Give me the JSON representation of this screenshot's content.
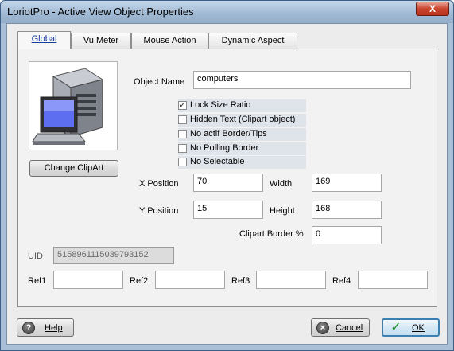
{
  "window": {
    "title": "LoriotPro - Active View Object Properties",
    "close_glyph": "X"
  },
  "tabs": [
    {
      "label": "Global",
      "active": true
    },
    {
      "label": "Vu Meter",
      "active": false
    },
    {
      "label": "Mouse Action",
      "active": false
    },
    {
      "label": "Dynamic Aspect",
      "active": false
    }
  ],
  "clipart": {
    "icon": "computer-icon",
    "button_label": "Change ClipArt"
  },
  "object_name": {
    "label": "Object Name",
    "value": "computers"
  },
  "checkboxes": [
    {
      "label": "Lock Size Ratio",
      "checked": true
    },
    {
      "label": "Hidden Text (Clipart object)",
      "checked": false
    },
    {
      "label": "No actif Border/Tips",
      "checked": false
    },
    {
      "label": "No Polling Border",
      "checked": false
    },
    {
      "label": "No Selectable",
      "checked": false
    }
  ],
  "position": {
    "x_label": "X Position",
    "x_value": "70",
    "y_label": "Y Position",
    "y_value": "15",
    "width_label": "Width",
    "width_value": "169",
    "height_label": "Height",
    "height_value": "168",
    "border_label": "Clipart Border %",
    "border_value": "0"
  },
  "uid": {
    "label": "UID",
    "value": "5158961115039793152"
  },
  "refs": [
    {
      "label": "Ref1",
      "value": ""
    },
    {
      "label": "Ref2",
      "value": ""
    },
    {
      "label": "Ref3",
      "value": ""
    },
    {
      "label": "Ref4",
      "value": ""
    }
  ],
  "footer": {
    "help_label": "Help",
    "help_icon": "help-icon",
    "cancel_label": "Cancel",
    "cancel_icon": "cancel-icon",
    "ok_label": "OK",
    "ok_icon": "ok-checkmark-icon"
  }
}
